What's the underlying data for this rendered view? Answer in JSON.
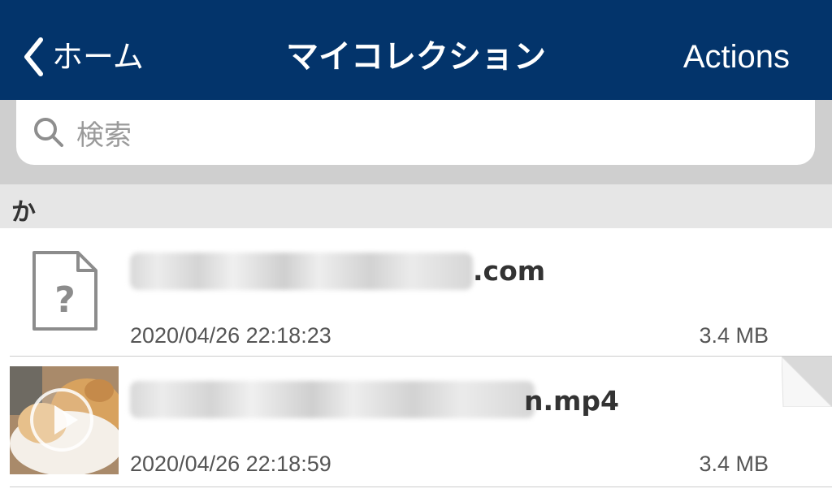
{
  "navbar": {
    "back_label": "ホーム",
    "title": "マイコレクション",
    "actions_label": "Actions",
    "background_color": "#03346b"
  },
  "search": {
    "placeholder": "検索"
  },
  "section": {
    "letter": "か"
  },
  "files": [
    {
      "name_visible_suffix": ".com",
      "date": "2020/04/26 22:18:23",
      "size": "3.4 MB",
      "icon": "unknown-file-icon"
    },
    {
      "name_visible_suffix": "n.mp4",
      "date": "2020/04/26 22:18:59",
      "size": "3.4 MB",
      "icon": "video-thumbnail"
    }
  ]
}
